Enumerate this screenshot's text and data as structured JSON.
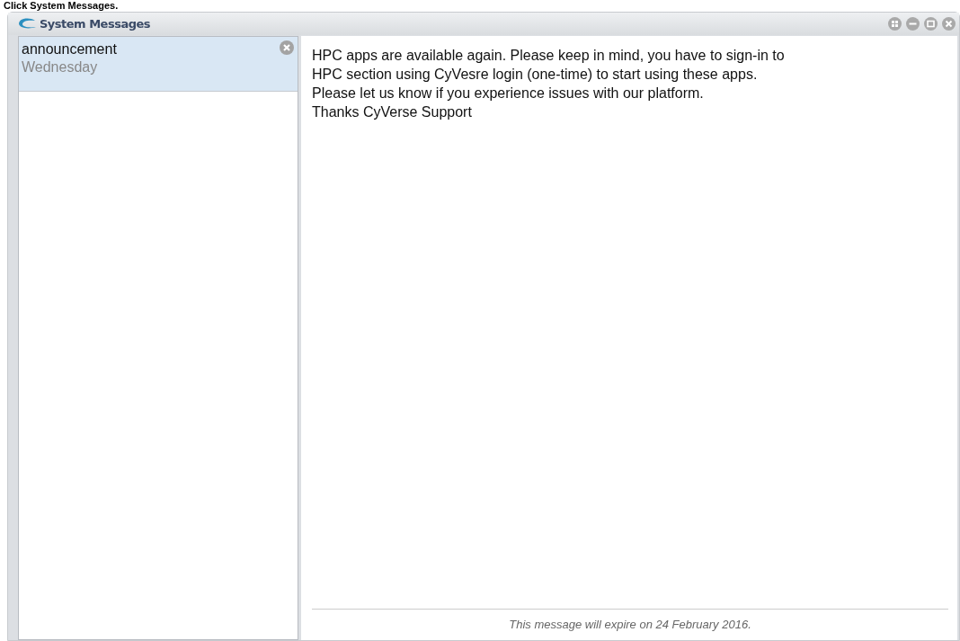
{
  "caption": "Click System Messages.",
  "window": {
    "title": "System Messages"
  },
  "messages": [
    {
      "type": "announcement",
      "date": "Wednesday",
      "selected": true
    }
  ],
  "message_body": [
    "HPC apps are available again. Please keep in mind, you have to sign-in to",
    "HPC section using CyVesre login (one-time) to start using these apps.",
    "Please let us know if you experience issues with our platform.",
    "Thanks CyVerse Support"
  ],
  "expiry_note": "This message will expire on 24 February 2016."
}
